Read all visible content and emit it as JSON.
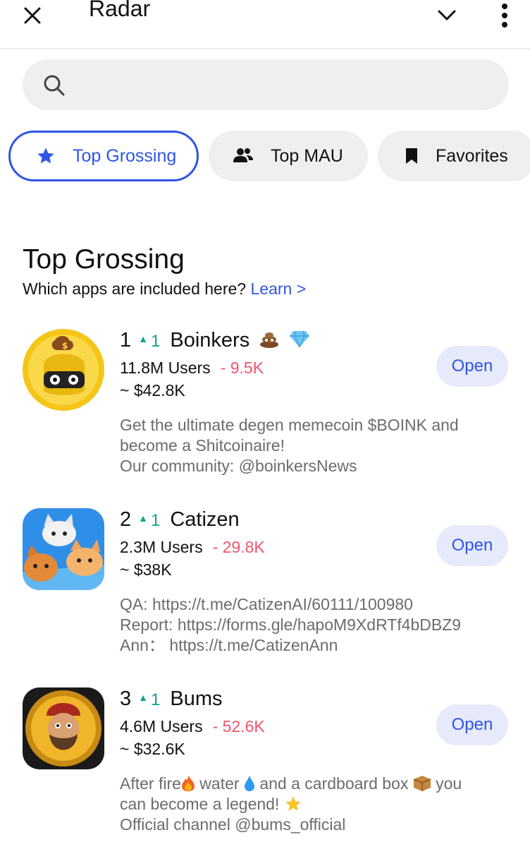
{
  "header": {
    "title": "Radar",
    "icons": [
      "close-icon",
      "chevron-down-icon",
      "more-vertical-icon"
    ]
  },
  "search": {
    "placeholder": "",
    "icon": "search-icon"
  },
  "tabs": [
    {
      "label": "Top Grossing",
      "icon": "star-icon",
      "active": true
    },
    {
      "label": "Top MAU",
      "icon": "users-icon",
      "active": false
    },
    {
      "label": "Favorites",
      "icon": "bookmark-icon",
      "active": false
    }
  ],
  "section": {
    "title": "Top Grossing",
    "subtitle": "Which apps are included here?",
    "learn_link": "Learn >"
  },
  "apps": [
    {
      "rank": "1",
      "rank_change": "1",
      "name": "Boinkers",
      "users": "11.8M Users",
      "users_change": "- 9.5K",
      "revenue": "~ $42.8K",
      "open_label": "Open",
      "desc": [
        "Get the ultimate degen memecoin $BOINK and",
        "become a Shitcoinaire!",
        "Our community: @boinkersNews"
      ]
    },
    {
      "rank": "2",
      "rank_change": "1",
      "name": "Catizen",
      "users": "2.3M Users",
      "users_change": "- 29.8K",
      "revenue": "~ $38K",
      "open_label": "Open",
      "desc": [
        "QA: https://t.me/CatizenAI/60111/100980",
        "Report: https://forms.gle/hapoM9XdRTf4bDBZ9",
        "Ann： https://t.me/CatizenAnn"
      ]
    },
    {
      "rank": "3",
      "rank_change": "1",
      "name": "Bums",
      "users": "4.6M Users",
      "users_change": "- 52.6K",
      "revenue": "~ $32.6K",
      "open_label": "Open",
      "desc": {
        "a": "After fire",
        "b": " water ",
        "c": " and a cardboard box ",
        "d": " you",
        "e": "can become a legend! ",
        "f": "Official channel @bums_official"
      }
    }
  ],
  "colors": {
    "accent": "#2f55e8",
    "positive": "#12a58a",
    "negative": "#f0556b",
    "pill": "#efefef",
    "open_bg": "#e6eafb"
  }
}
